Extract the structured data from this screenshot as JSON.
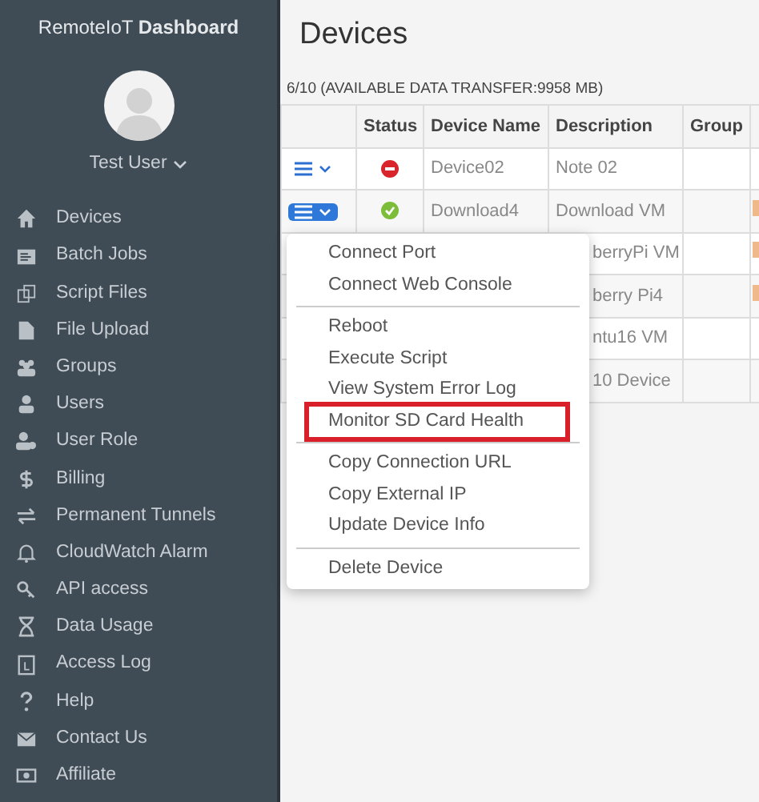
{
  "sidebar": {
    "brand": "RemoteIoT",
    "brand_bold": "Dashboard",
    "user": "Test User",
    "items": [
      {
        "label": "Devices"
      },
      {
        "label": "Batch Jobs"
      },
      {
        "label": "Script Files"
      },
      {
        "label": "File Upload"
      },
      {
        "label": "Groups"
      },
      {
        "label": "Users"
      },
      {
        "label": "User Role"
      },
      {
        "label": "Billing"
      },
      {
        "label": "Permanent Tunnels"
      },
      {
        "label": "CloudWatch Alarm"
      },
      {
        "label": "API access"
      },
      {
        "label": "Data Usage"
      },
      {
        "label": "Access Log"
      },
      {
        "label": "Help"
      },
      {
        "label": "Contact Us"
      },
      {
        "label": "Affiliate"
      }
    ]
  },
  "page": {
    "title": "Devices",
    "summary": "6/10 (AVAILABLE DATA TRANSFER:9958 MB)"
  },
  "table": {
    "columns": [
      "",
      "Status",
      "Device Name",
      "Description",
      "Group"
    ],
    "rows": [
      {
        "menu_open": false,
        "online": false,
        "device_name": "Device02",
        "description": "Note 02",
        "flag": false
      },
      {
        "menu_open": true,
        "online": true,
        "device_name": "Download4",
        "description": "Download VM",
        "flag": true
      },
      {
        "description": "berryPi VM",
        "flag": true
      },
      {
        "description": "berry Pi4",
        "flag": true
      },
      {
        "description": "ntu16 VM",
        "flag": false
      },
      {
        "description": "10 Device",
        "flag": false
      }
    ]
  },
  "menu": {
    "groups": [
      [
        {
          "label": "Connect Port",
          "highlighted": false
        },
        {
          "label": "Connect Web Console",
          "highlighted": false
        }
      ],
      [
        {
          "label": "Reboot",
          "highlighted": false
        },
        {
          "label": "Execute Script",
          "highlighted": false
        },
        {
          "label": "View System Error Log",
          "highlighted": false
        },
        {
          "label": "Monitor SD Card Health",
          "highlighted": true
        }
      ],
      [
        {
          "label": "Copy Connection URL",
          "highlighted": false
        },
        {
          "label": "Copy External IP",
          "highlighted": false
        },
        {
          "label": "Update Device Info",
          "highlighted": false
        }
      ],
      [
        {
          "label": "Delete Device",
          "highlighted": false
        }
      ]
    ]
  }
}
